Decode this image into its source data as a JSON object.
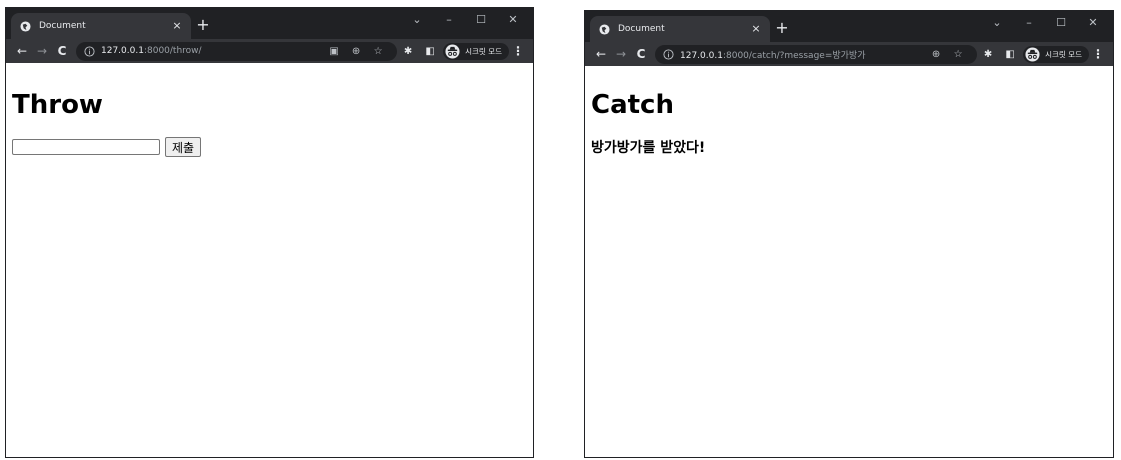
{
  "colors": {
    "titlebar": "#202124",
    "toolbar": "#35363a",
    "tab_active": "#35363a",
    "omnibox": "#202124",
    "text_light": "#e8eaed",
    "text_muted": "#9aa0a6"
  },
  "left_window": {
    "tab": {
      "title": "Document",
      "close": "×"
    },
    "new_tab": "+",
    "window_controls": {
      "dropdown": "⌄",
      "minimize": "–",
      "maximize": "☐",
      "close": "✕"
    },
    "nav": {
      "back": "←",
      "forward": "→",
      "reload": "C"
    },
    "url": {
      "host": "127.0.0.1",
      "path": ":8000/throw/"
    },
    "incognito_label": "시크릿 모드",
    "page": {
      "heading": "Throw",
      "input_value": "",
      "submit_label": "제출"
    }
  },
  "right_window": {
    "tab": {
      "title": "Document",
      "close": "×"
    },
    "new_tab": "+",
    "window_controls": {
      "dropdown": "⌄",
      "minimize": "–",
      "maximize": "☐",
      "close": "✕"
    },
    "nav": {
      "back": "←",
      "forward": "→",
      "reload": "C"
    },
    "url": {
      "host": "127.0.0.1",
      "path": ":8000/catch/?message=방가방가"
    },
    "incognito_label": "시크릿 모드",
    "page": {
      "heading": "Catch",
      "message": "방가방가를 받았다!"
    }
  }
}
